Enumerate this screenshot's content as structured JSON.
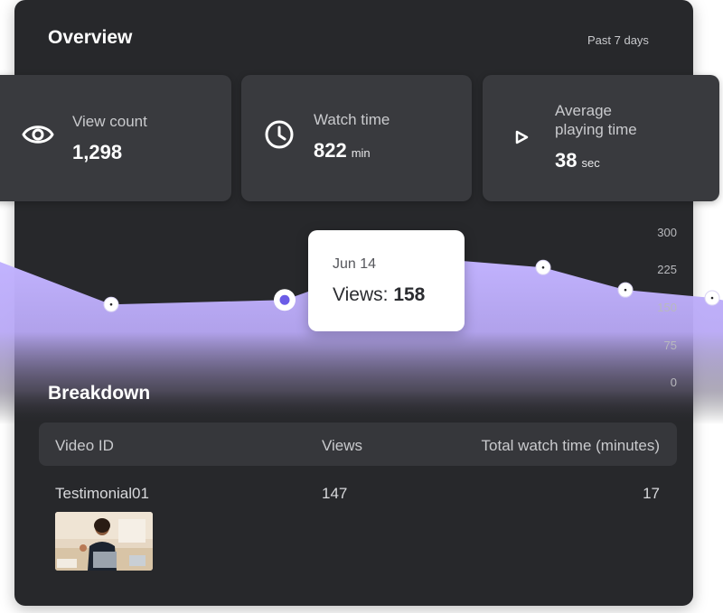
{
  "overview": {
    "title": "Overview",
    "period": "Past 7 days"
  },
  "stats": [
    {
      "icon": "eye-icon",
      "label": "View count",
      "value": "1,298",
      "unit": ""
    },
    {
      "icon": "clock-icon",
      "label": "Watch time",
      "value": "822",
      "unit": "min"
    },
    {
      "icon": "play-icon",
      "label_line1": "Average",
      "label_line2": "playing time",
      "value": "38",
      "unit": "sec"
    }
  ],
  "chart_data": {
    "type": "area",
    "y_ticks": [
      "300",
      "225",
      "150",
      "75",
      "0"
    ],
    "ylim": [
      0,
      300
    ],
    "series": [
      {
        "values": [
          null,
          155,
          164,
          251,
          229,
          184,
          168
        ]
      }
    ],
    "highlighted_index": 2,
    "fill_color": "#c2b3ff",
    "point_color": "#6b5ce7"
  },
  "tooltip": {
    "date": "Jun 14",
    "views_label": "Views:",
    "views_value": "158"
  },
  "breakdown": {
    "title": "Breakdown",
    "columns": [
      "Video ID",
      "Views",
      "Total watch time (minutes)"
    ],
    "rows": [
      {
        "video_id": "Testimonial01",
        "views": "147",
        "watch_time": "17"
      }
    ]
  }
}
